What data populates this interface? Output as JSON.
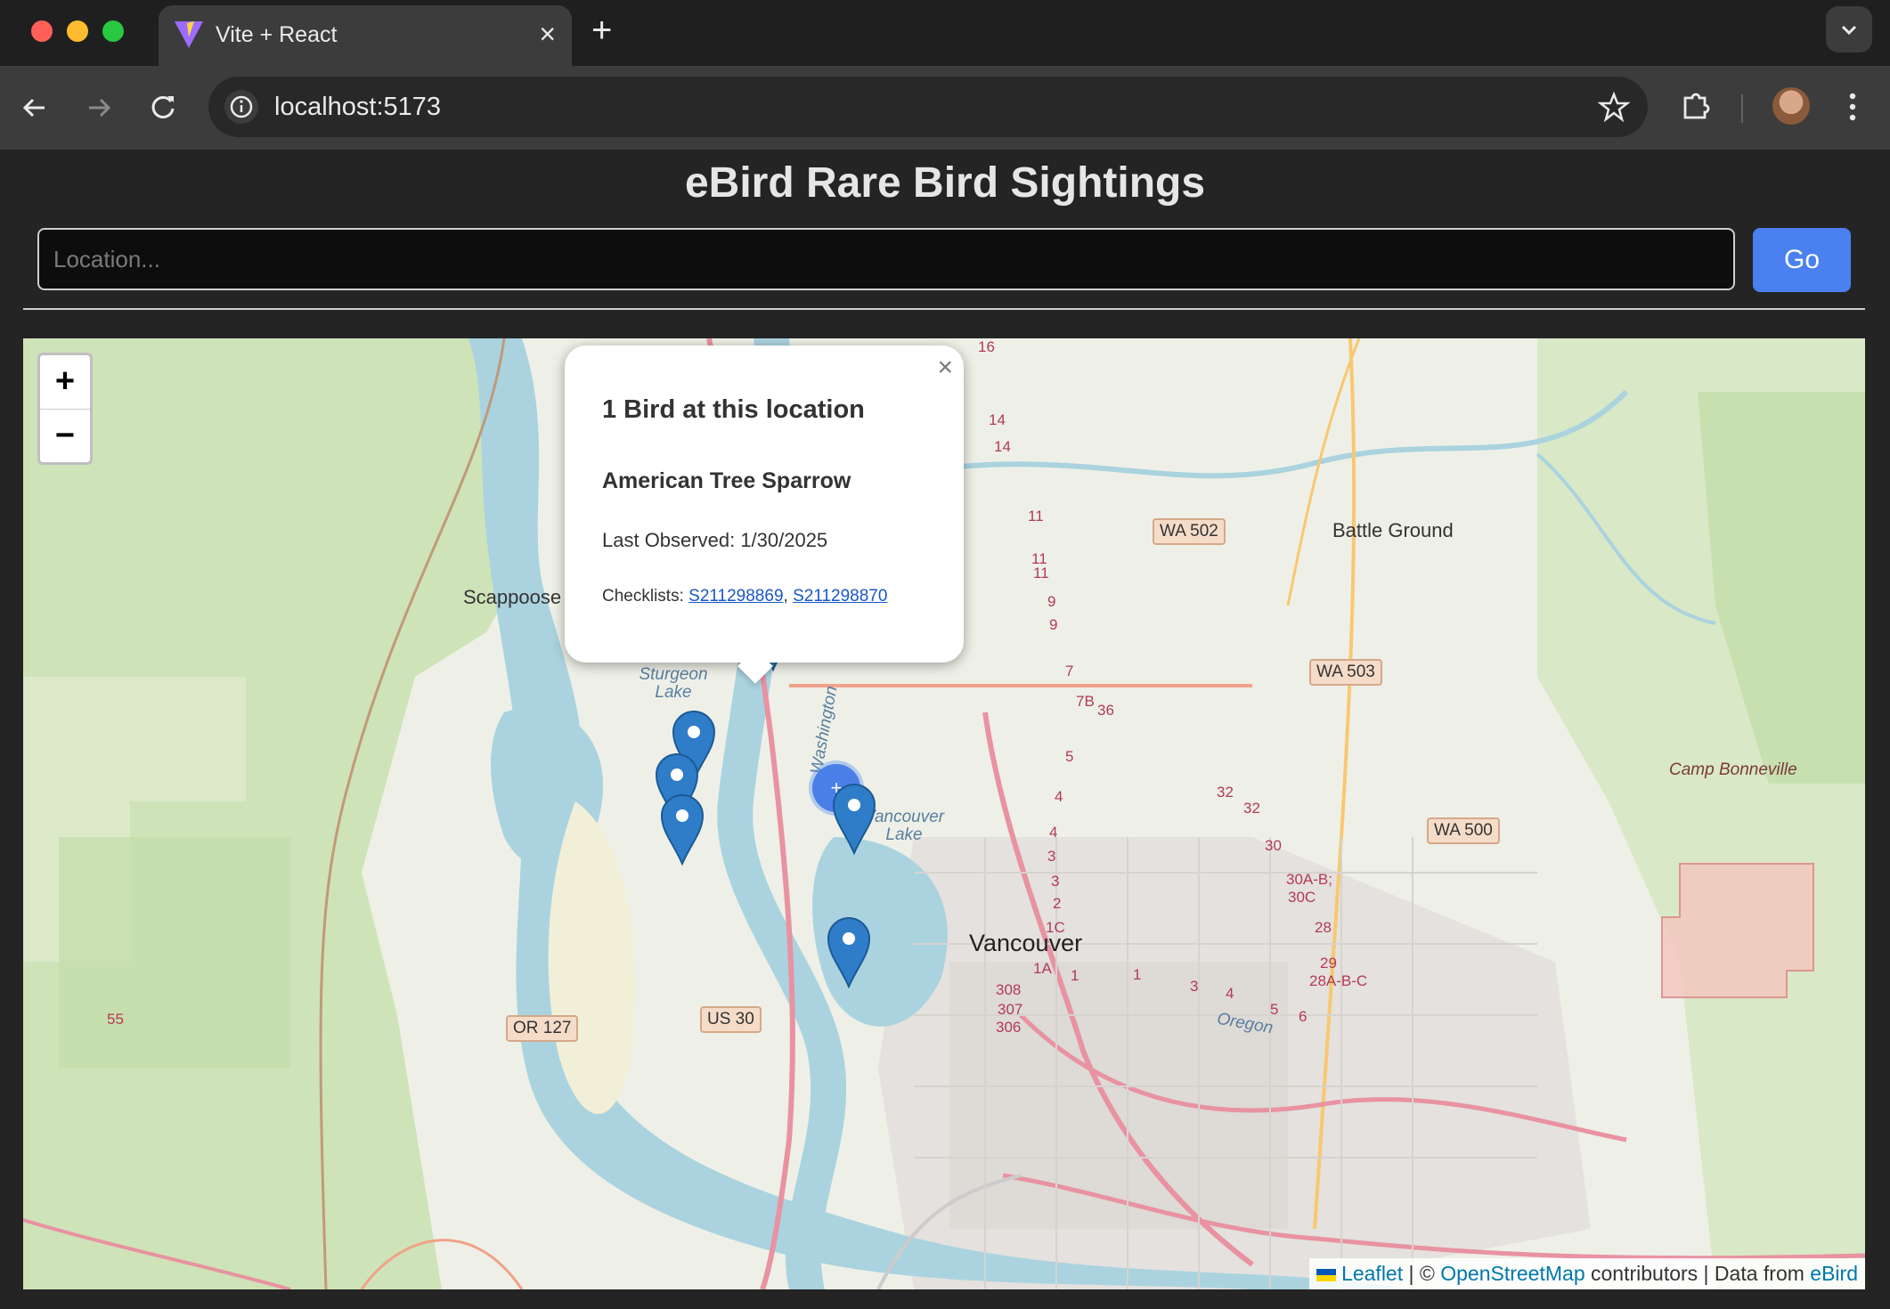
{
  "browser": {
    "tab_title": "Vite + React",
    "tab_close": "×",
    "new_tab": "+",
    "url": "localhost:5173"
  },
  "app": {
    "title": "eBird Rare Bird Sightings",
    "search_placeholder": "Location...",
    "go_label": "Go"
  },
  "map": {
    "zoom_in": "+",
    "zoom_out": "−",
    "labels": {
      "scappoose": "Scappoose",
      "battle_ground": "Battle Ground",
      "vancouver": "Vancouver",
      "sturgeon_lake": "Sturgeon Lake",
      "vancouver_lake": "Vancouver Lake",
      "washington": "Washington",
      "oregon": "Oregon",
      "camp_bonneville": "Camp Bonneville"
    },
    "shields": {
      "wa502": "WA 502",
      "wa503": "WA 503",
      "wa500": "WA 500",
      "or127": "OR 127",
      "us30": "US 30"
    },
    "route_numbers": [
      "16",
      "14",
      "14",
      "11",
      "11",
      "11",
      "9",
      "9",
      "7",
      "7B",
      "36",
      "5",
      "4",
      "4",
      "3",
      "3",
      "2",
      "1C",
      "1A",
      "32",
      "32",
      "30",
      "30A-B;",
      "30C",
      "28",
      "29",
      "28A-B-C",
      "308",
      "307",
      "306",
      "55",
      "1",
      "1",
      "3",
      "4",
      "5",
      "6"
    ],
    "cluster_labels": [
      "+",
      "+"
    ],
    "popup": {
      "close": "×",
      "heading": "1 Bird at this location",
      "species": "American Tree Sparrow",
      "last_observed": "Last Observed: 1/30/2025",
      "checklists_label": "Checklists:",
      "checklist_1": "S211298869",
      "checklist_sep": ",",
      "checklist_2": "S211298870"
    },
    "attribution": {
      "leaflet": "Leaflet",
      "sep1": "|",
      "copyright": "©",
      "osm": "OpenStreetMap",
      "contributors": "contributors | Data from",
      "ebird": "eBird"
    }
  }
}
